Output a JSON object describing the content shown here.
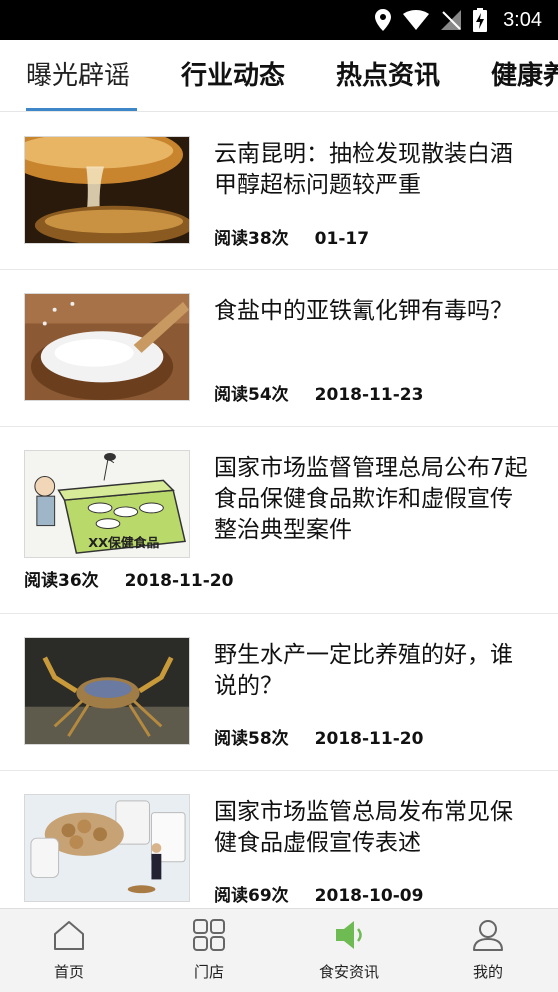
{
  "status_bar": {
    "time": "3:04"
  },
  "tabs": [
    {
      "label": "曝光辟谣"
    },
    {
      "label": "行业动态"
    },
    {
      "label": "热点资讯"
    },
    {
      "label": "健康养"
    }
  ],
  "articles": [
    {
      "title": "云南昆明：抽检发现散装白酒甲醇超标问题较严重",
      "reads": "阅读38次",
      "date": "01-17",
      "thumb": "liquor-pouring"
    },
    {
      "title": "食盐中的亚铁氰化钾有毒吗？",
      "reads": "阅读54次",
      "date": "2018-11-23",
      "thumb": "salt-bowl"
    },
    {
      "title": "国家市场监督管理总局公布7起食品保健食品欺诈和虚假宣传整治典型案件",
      "reads": "阅读36次",
      "date": "2018-11-20",
      "thumb": "health-food-cartoon",
      "thumb_text": "XX保健食品"
    },
    {
      "title": "野生水产一定比养殖的好，谁说的？",
      "reads": "阅读58次",
      "date": "2018-11-20",
      "thumb": "crab"
    },
    {
      "title": "国家市场监管总局发布常见保健食品虚假宣传表述",
      "reads": "阅读69次",
      "date": "2018-10-09",
      "thumb": "pills-bottle"
    }
  ],
  "bottom_nav": [
    {
      "label": "首页",
      "icon": "home-icon",
      "active": false
    },
    {
      "label": "门店",
      "icon": "grid-icon",
      "active": false
    },
    {
      "label": "食安资讯",
      "icon": "speaker-icon",
      "active": true
    },
    {
      "label": "我的",
      "icon": "user-icon",
      "active": false
    }
  ],
  "colors": {
    "accent": "#3d86c7",
    "nav_active": "#6dbb52",
    "status_bar": "#000000"
  }
}
